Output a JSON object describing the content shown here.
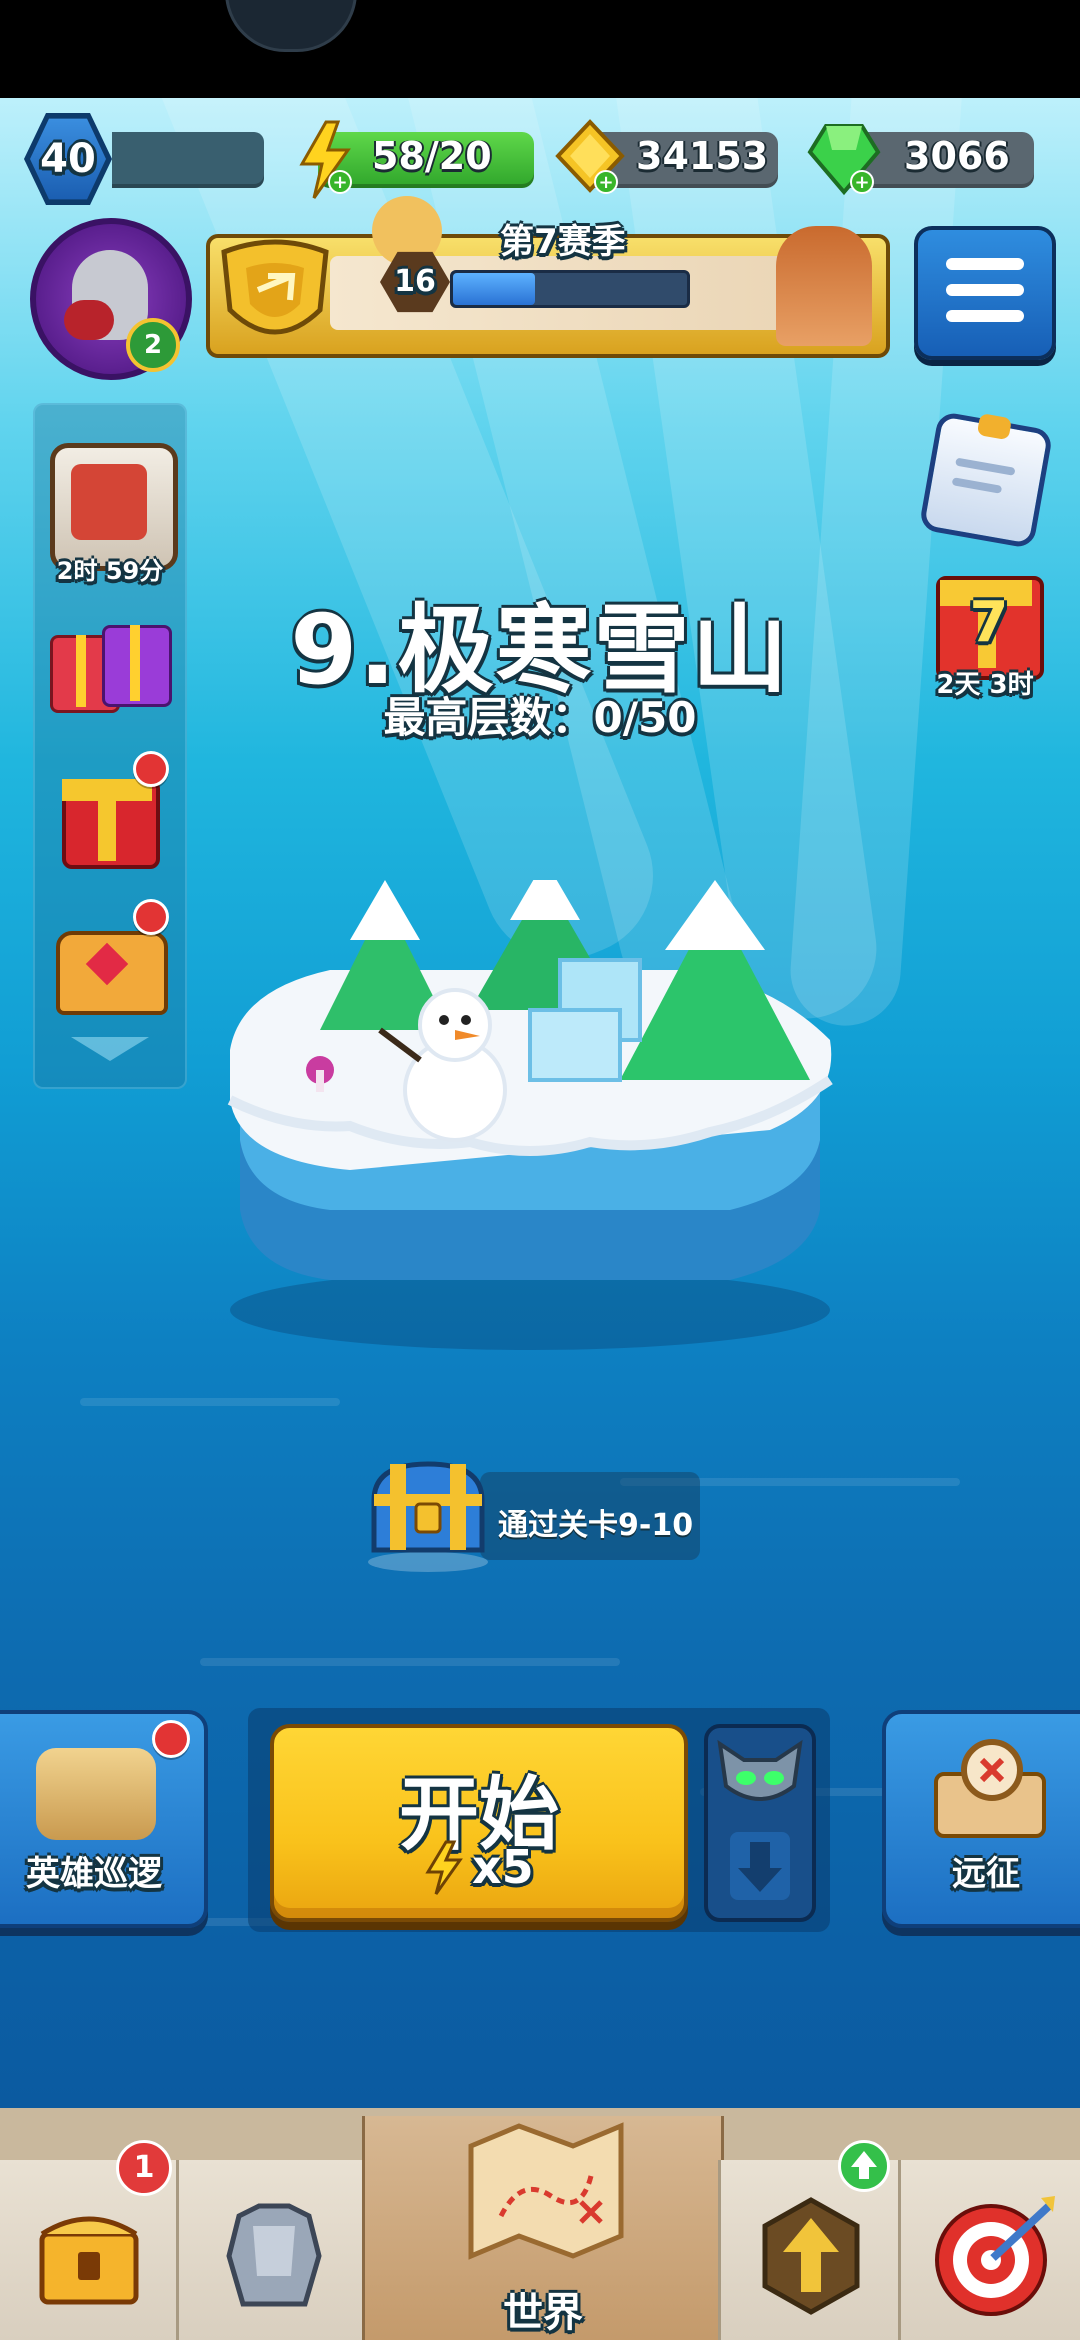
{
  "player": {
    "level": "40",
    "avatar_badge": "2"
  },
  "resources": {
    "energy": "58/20",
    "gold": "34153",
    "gems": "3066"
  },
  "season": {
    "title": "第7赛季",
    "rank": "16",
    "progress": 0.35
  },
  "sidebar": {
    "book_timer": "2时 59分"
  },
  "right_panel": {
    "gift_day": "7",
    "gift_timer": "2天 3时"
  },
  "chapter": {
    "title": "9.极寒雪山",
    "best_floor": "最高层数：0/50"
  },
  "reward": {
    "label": "通过关卡9-10"
  },
  "actions": {
    "hero_patrol": "英雄巡逻",
    "start": "开始",
    "start_cost": "x5",
    "expedition": "远征"
  },
  "nav": {
    "chest_badge": "1",
    "world": "世界"
  },
  "colors": {
    "accent_yellow": "#f9c21b",
    "button_blue": "#1c6fc2",
    "energy_green": "#4cc43a",
    "gem_green": "#3bd14a"
  }
}
